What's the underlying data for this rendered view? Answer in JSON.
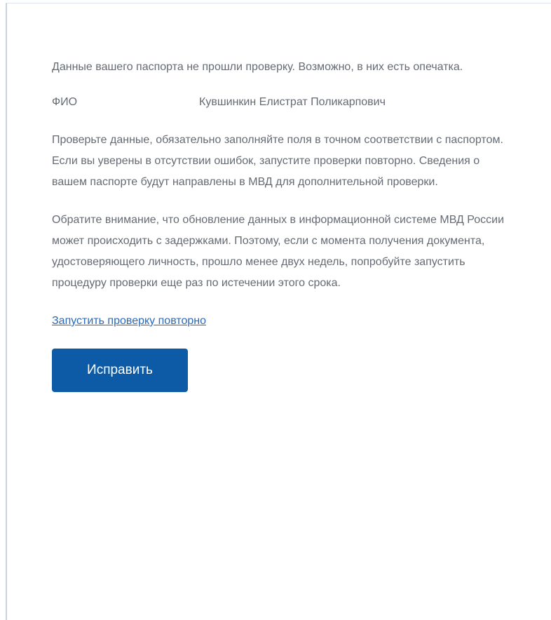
{
  "passport_error": {
    "message": "Данные вашего паспорта не прошли проверку. Возможно, в них есть опечатка.",
    "fio_label": "ФИО",
    "fio_value": "Кувшинкин Елистрат Поликарпович",
    "instructions": "Проверьте данные, обязательно заполняйте поля в точном соответствии с паспортом. Если вы уверены в отсутствии ошибок, запустите проверки повторно. Сведения о вашем паспорте будут направлены в МВД для дополнительной проверки.",
    "note": "Обратите внимание, что обновление данных в информационной системе МВД России может происходить с задержками. Поэтому, если с момента получения документа, удостоверяющего личность, прошло менее двух недель, попробуйте запустить процедуру проверки еще раз по истечении этого срока.",
    "retry_link": "Запустить проверку повторно",
    "fix_button": "Исправить"
  },
  "colors": {
    "text": "#656b74",
    "link": "#2a6ab8",
    "button": "#0d5aa7"
  }
}
